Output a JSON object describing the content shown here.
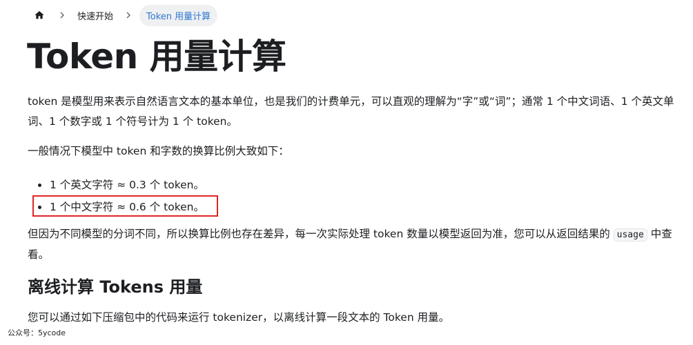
{
  "breadcrumb": {
    "home_label": "",
    "items": [
      "快速开始",
      "Token 用量计算"
    ]
  },
  "title": "Token 用量计算",
  "paragraphs": {
    "p1": "token 是模型用来表示自然语言文本的基本单位，也是我们的计费单元，可以直观的理解为“字”或“词”；通常 1 个中文词语、1 个英文单词、1 个数字或 1 个符号计为 1 个 token。",
    "p2": "一般情况下模型中 token 和字数的换算比例大致如下：",
    "p3_before": "但因为不同模型的分词不同，所以换算比例也存在差异，每一次实际处理 token 数量以模型返回为准，您可以从返回结果的 ",
    "p3_code": "usage",
    "p3_after": " 中查看。",
    "p4": "您可以通过如下压缩包中的代码来运行 tokenizer，以离线计算一段文本的 Token 用量。"
  },
  "bullets": [
    "1 个英文字符 ≈ 0.3 个 token。",
    "1 个中文字符 ≈ 0.6 个 token。"
  ],
  "subtitle": "离线计算 Tokens 用量",
  "watermark": "公众号：5ycode",
  "cut_off_text": "离线计算 Tokens 用量",
  "colors": {
    "text": "#1c1e21",
    "link_active": "#2e77d0",
    "highlight_border": "#e02424",
    "crumb_active_bg": "#eef0f2"
  },
  "icons": {
    "home": "home-icon",
    "separator": "chevron-right-icon"
  }
}
